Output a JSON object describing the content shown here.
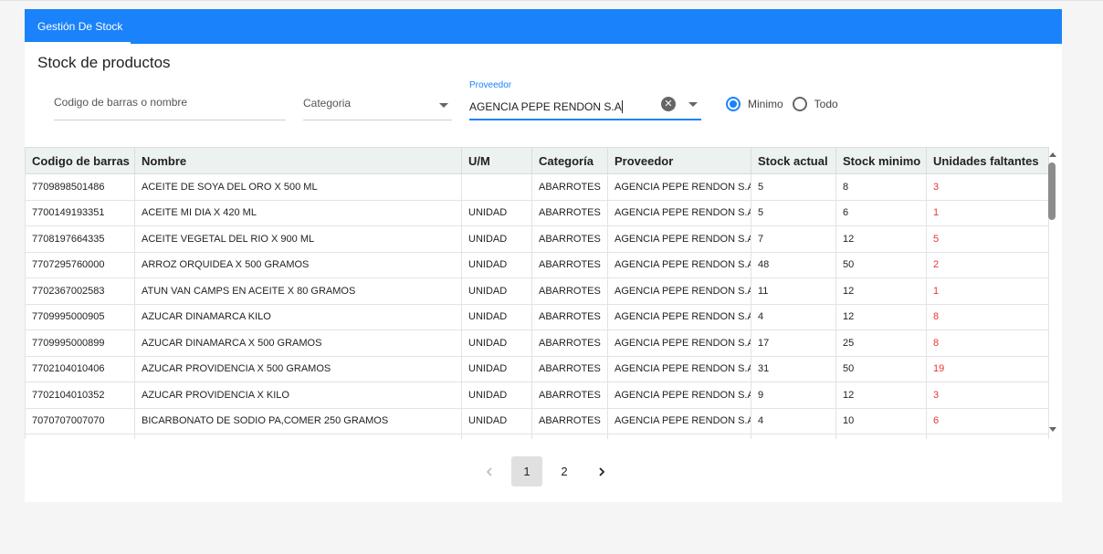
{
  "tabs": [
    {
      "label": "Gestión De Stock",
      "active": true
    }
  ],
  "page_title": "Stock de productos",
  "filters": {
    "search_placeholder": "Codigo de barras o nombre",
    "category_label": "Categoria",
    "provider_label": "Proveedor",
    "provider_value": "AGENCIA PEPE RENDON S.A",
    "radio_min": "Minimo",
    "radio_all": "Todo",
    "selected": "Minimo"
  },
  "table": {
    "headers": [
      "Codigo de barras",
      "Nombre",
      "U/M",
      "Categoría",
      "Proveedor",
      "Stock actual",
      "Stock minimo",
      "Unidades faltantes"
    ],
    "rows": [
      [
        "7709898501486",
        "ACEITE DE SOYA DEL ORO X 500 ML",
        "",
        "ABARROTES",
        "AGENCIA PEPE RENDON S.A",
        "5",
        "8",
        "3"
      ],
      [
        "7700149193351",
        "ACEITE MI DIA X 420 ML",
        "UNIDAD",
        "ABARROTES",
        "AGENCIA PEPE RENDON S.A",
        "5",
        "6",
        "1"
      ],
      [
        "7708197664335",
        "ACEITE VEGETAL DEL RIO X 900 ML",
        "UNIDAD",
        "ABARROTES",
        "AGENCIA PEPE RENDON S.A",
        "7",
        "12",
        "5"
      ],
      [
        "7707295760000",
        "ARROZ ORQUIDEA X 500 GRAMOS",
        "UNIDAD",
        "ABARROTES",
        "AGENCIA PEPE RENDON S.A",
        "48",
        "50",
        "2"
      ],
      [
        "7702367002583",
        "ATUN VAN CAMPS EN ACEITE X 80 GRAMOS",
        "UNIDAD",
        "ABARROTES",
        "AGENCIA PEPE RENDON S.A",
        "11",
        "12",
        "1"
      ],
      [
        "7709995000905",
        "AZUCAR DINAMARCA KILO",
        "UNIDAD",
        "ABARROTES",
        "AGENCIA PEPE RENDON S.A",
        "4",
        "12",
        "8"
      ],
      [
        "7709995000899",
        "AZUCAR DINAMARCA X 500 GRAMOS",
        "UNIDAD",
        "ABARROTES",
        "AGENCIA PEPE RENDON S.A",
        "17",
        "25",
        "8"
      ],
      [
        "7702104010406",
        "AZUCAR PROVIDENCIA X 500 GRAMOS",
        "UNIDAD",
        "ABARROTES",
        "AGENCIA PEPE RENDON S.A",
        "31",
        "50",
        "19"
      ],
      [
        "7702104010352",
        "AZUCAR PROVIDENCIA X KILO",
        "UNIDAD",
        "ABARROTES",
        "AGENCIA PEPE RENDON S.A",
        "9",
        "12",
        "3"
      ],
      [
        "7070707007070",
        "BICARBONATO DE SODIO PA,COMER 250 GRAMOS",
        "UNIDAD",
        "ABARROTES",
        "AGENCIA PEPE RENDON S.A",
        "4",
        "10",
        "6"
      ]
    ]
  },
  "pagination": {
    "pages": [
      "1",
      "2"
    ],
    "current": "1"
  },
  "colors": {
    "accent": "#1a82fb",
    "missing": "#e53935",
    "header_bg": "#ebf2ef"
  },
  "icons": {
    "clear": "clear-circle-icon",
    "dropdown": "caret-down-icon",
    "prev": "chevron-left-icon",
    "next": "chevron-right-icon"
  }
}
